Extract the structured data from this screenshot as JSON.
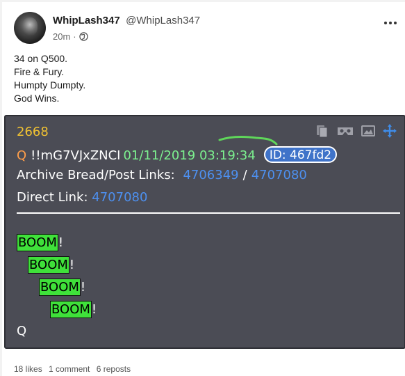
{
  "author": {
    "display_name": "WhipLash347",
    "handle": "@WhipLash347",
    "time": "20m",
    "visibility_icon": "globe-icon"
  },
  "post": {
    "lines": [
      "34 on Q500.",
      "Fire & Fury.",
      "Humpty Dumpty.",
      "God Wins."
    ]
  },
  "qpost": {
    "number": "2668",
    "q": "Q",
    "tripcode": "!!mG7VJxZNCI",
    "timestamp": "01/11/2019 03:19:34",
    "id_label": "ID: 467fd2",
    "archive_label": "Archive Bread/Post Links:",
    "archive_link_1": "4706349",
    "archive_sep": "/",
    "archive_link_2": "4707080",
    "direct_label": "Direct Link:",
    "direct_link": "4707080",
    "booms": [
      {
        "word": "BOOM",
        "punct": "!"
      },
      {
        "word": "BOOM",
        "punct": "!"
      },
      {
        "word": "BOOM",
        "punct": "!"
      },
      {
        "word": "BOOM",
        "punct": "!"
      }
    ],
    "signature": "Q",
    "toolbar_icons": [
      "copy-icon",
      "vr-icon",
      "image-icon",
      "move-icon"
    ],
    "colors": {
      "background": "#4b4c55",
      "number": "#f1c232",
      "timestamp": "#7cf08f",
      "link": "#4d90f0",
      "boom_highlight": "#3fe13a",
      "id_badge": "#3f73c9"
    }
  },
  "stats": {
    "likes": "18 likes",
    "comments": "1 comment",
    "reposts": "6 reposts"
  }
}
